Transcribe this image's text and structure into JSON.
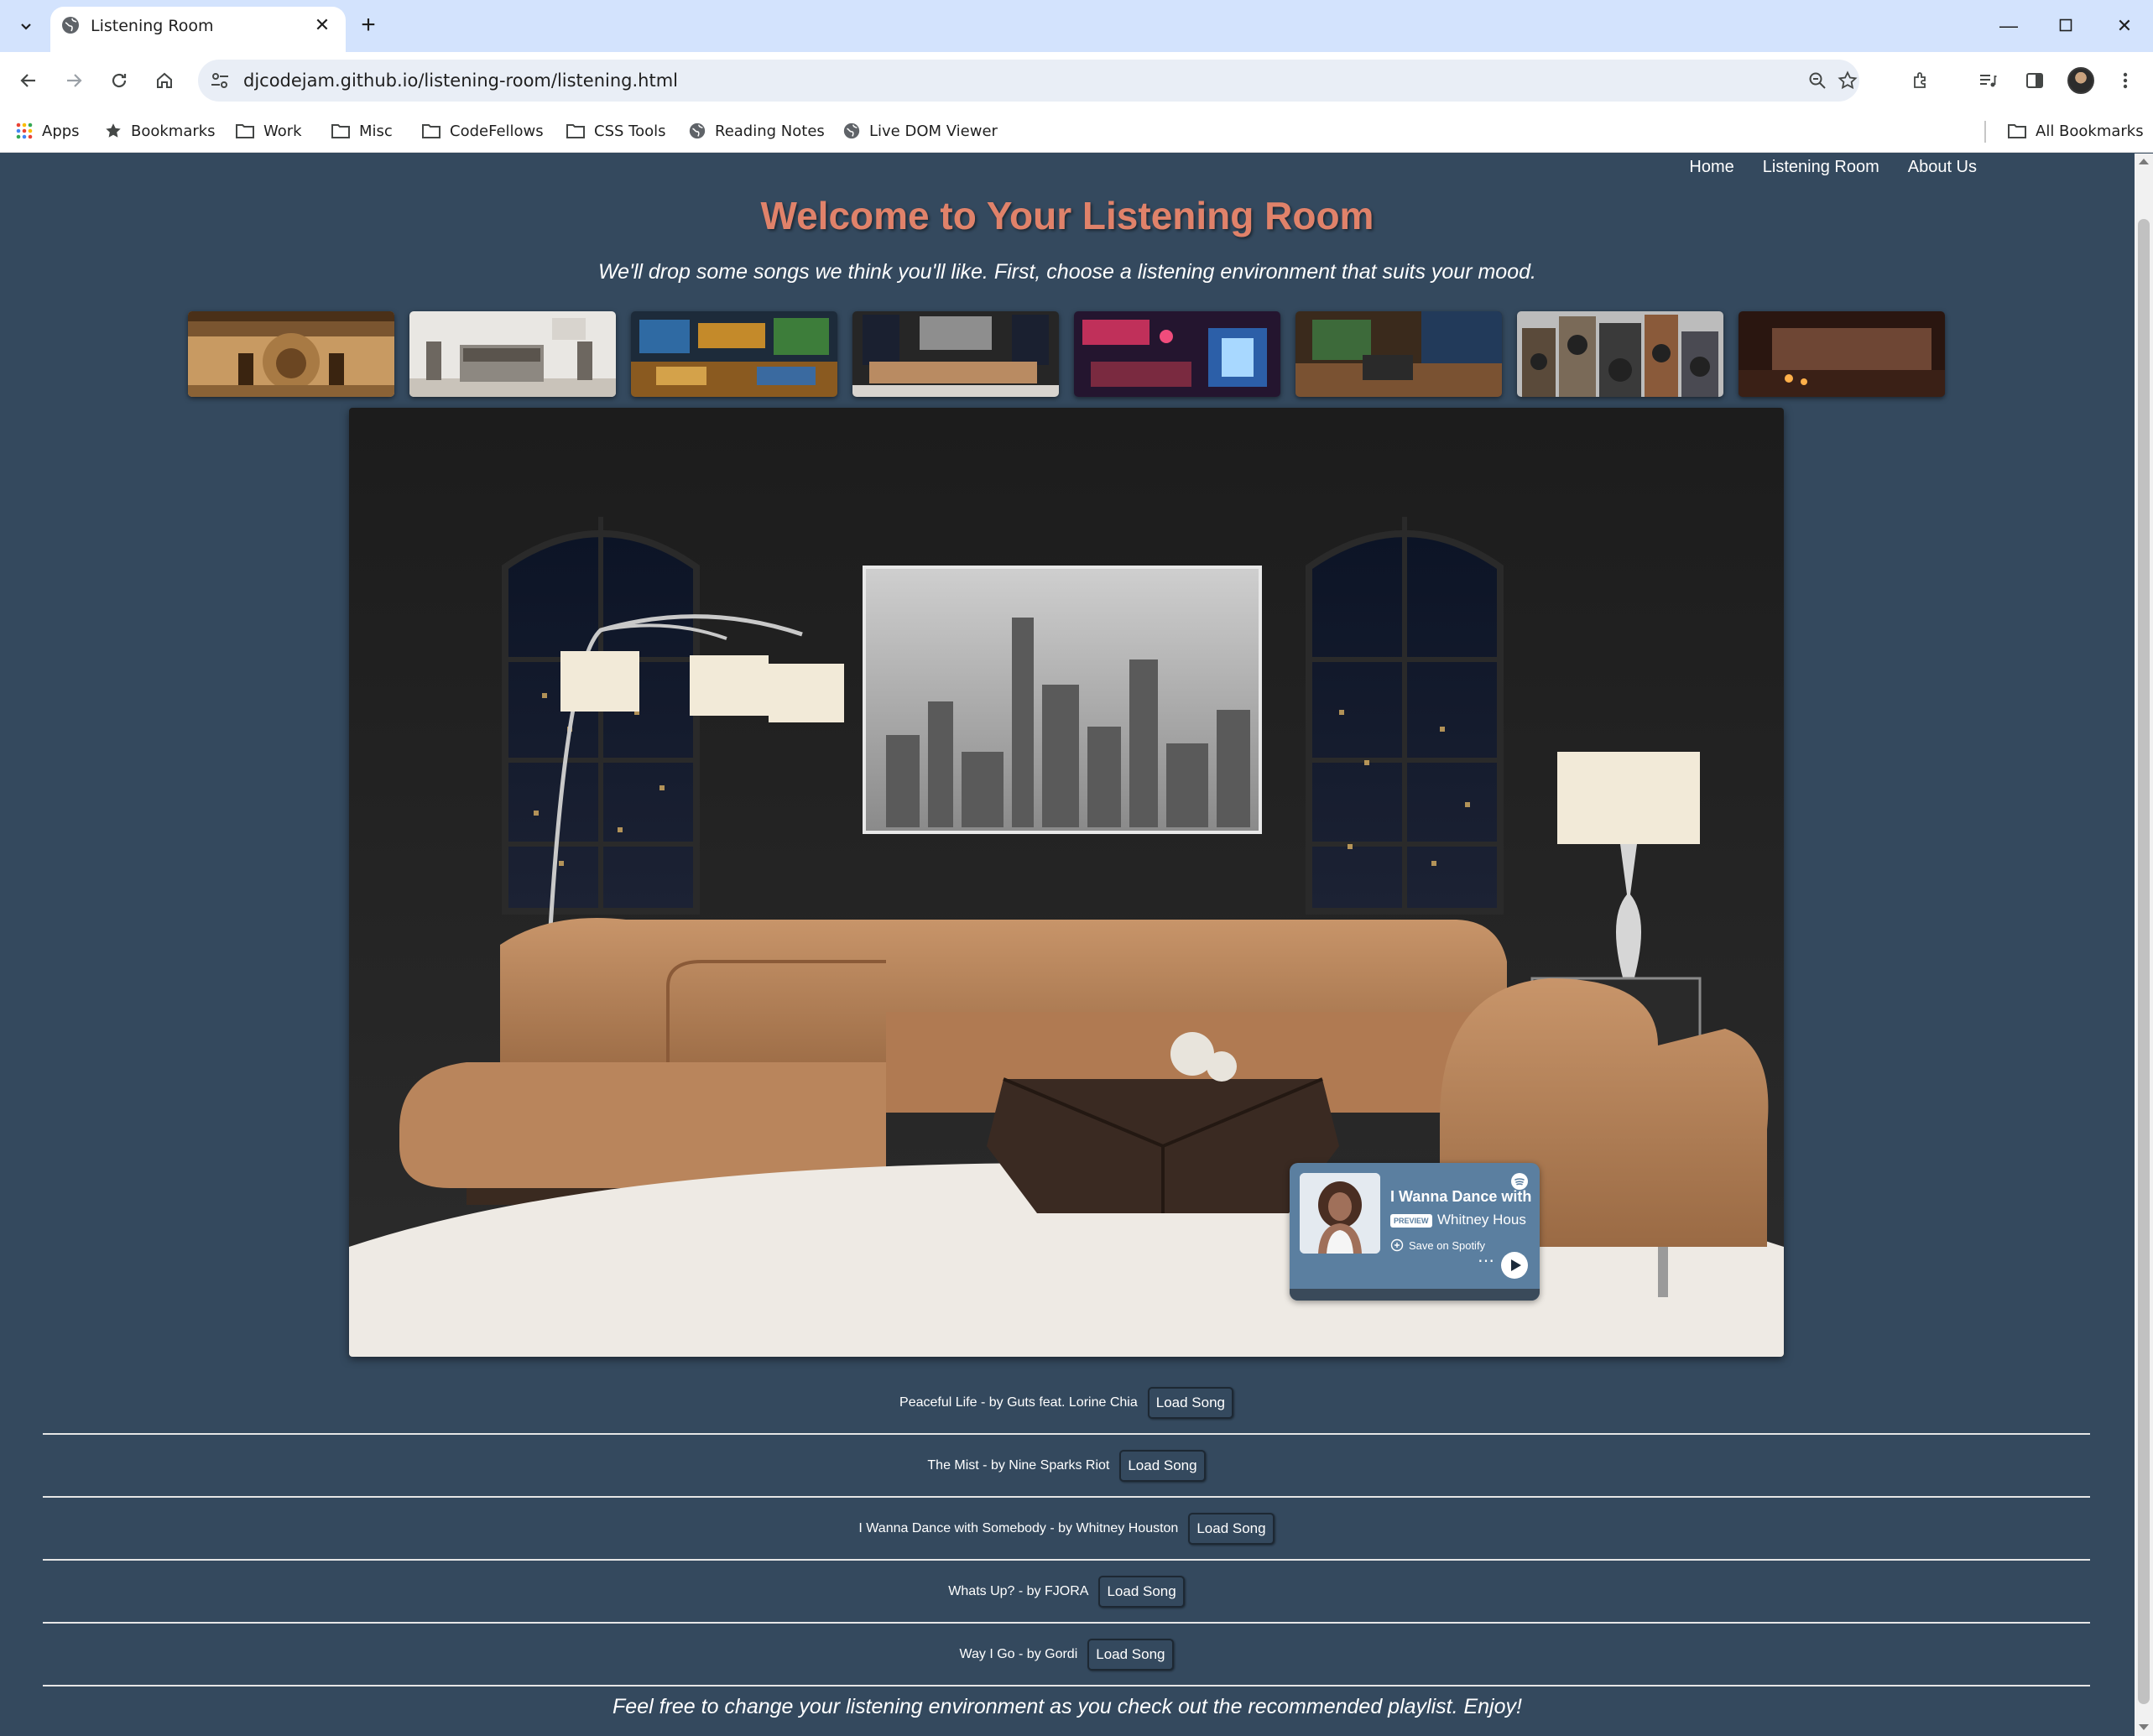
{
  "browser": {
    "tab_title": "Listening Room",
    "url": "djcodejam.github.io/listening-room/listening.html",
    "bookmarks": [
      {
        "label": "Apps",
        "icon": "apps-grid-icon"
      },
      {
        "label": "Bookmarks",
        "icon": "star-icon"
      },
      {
        "label": "Work",
        "icon": "folder-icon"
      },
      {
        "label": "Misc",
        "icon": "folder-icon"
      },
      {
        "label": "CodeFellows",
        "icon": "folder-icon"
      },
      {
        "label": "CSS Tools",
        "icon": "folder-icon"
      },
      {
        "label": "Reading Notes",
        "icon": "globe-icon"
      },
      {
        "label": "Live DOM Viewer",
        "icon": "globe-icon"
      }
    ],
    "all_bookmarks": "All Bookmarks"
  },
  "site": {
    "nav": [
      "Home",
      "Listening Room",
      "About Us"
    ],
    "title": "Welcome to Your Listening Room",
    "subtitle": "We'll drop some songs we think you'll like. First, choose a listening environment that suits your mood.",
    "environments": [
      "warm-wood-studio",
      "white-minimal-room",
      "neon-gaming-room",
      "city-night-loft",
      "retro-neon-lounge",
      "acoustic-studio",
      "speaker-wall",
      "candlelit-bedroom"
    ],
    "player": {
      "title": "I Wanna Dance with",
      "preview_badge": "PREVIEW",
      "artist": "Whitney Hous",
      "save_label": "Save on Spotify",
      "more": "⋯"
    },
    "songs": [
      {
        "label": "Peaceful Life - by Guts feat. Lorine Chia",
        "button": "Load Song"
      },
      {
        "label": "The Mist - by Nine Sparks Riot",
        "button": "Load Song"
      },
      {
        "label": "I Wanna Dance with Somebody - by Whitney Houston",
        "button": "Load Song"
      },
      {
        "label": "Whats Up? - by FJORA",
        "button": "Load Song"
      },
      {
        "label": "Way I Go - by Gordi",
        "button": "Load Song"
      }
    ],
    "footer": "Feel free to change your listening environment as you check out the recommended playlist. Enjoy!"
  },
  "colors": {
    "page_bg": "#34495e",
    "title": "#e0826a",
    "player_bg": "#5b7fa0",
    "chrome_tabbar": "#d3e3fd"
  }
}
